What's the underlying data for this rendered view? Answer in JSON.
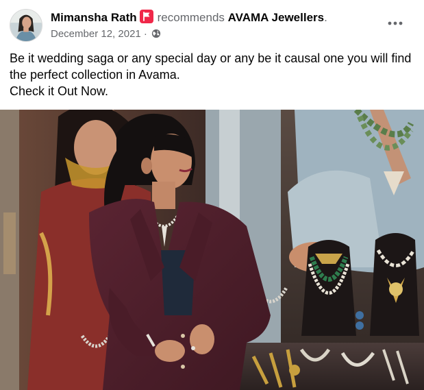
{
  "post": {
    "author": "Mimansha Rath",
    "recommends_text": "recommends",
    "page_name": "AVAMA Jewellers",
    "period": ".",
    "date": "December 12, 2021",
    "separator": "·",
    "privacy_icon": "globe-icon",
    "recommend_icon": "recommendation-flag-icon",
    "more_icon": "more-options-icon",
    "text_line_1": "Be it wedding saga or any special day or any be it causal one you will find the perfect collection in Avama.",
    "text_line_2": "Check it Out Now."
  },
  "colors": {
    "primary_text": "#050505",
    "secondary_text": "#65676b",
    "recommend_red": "#f02849"
  }
}
